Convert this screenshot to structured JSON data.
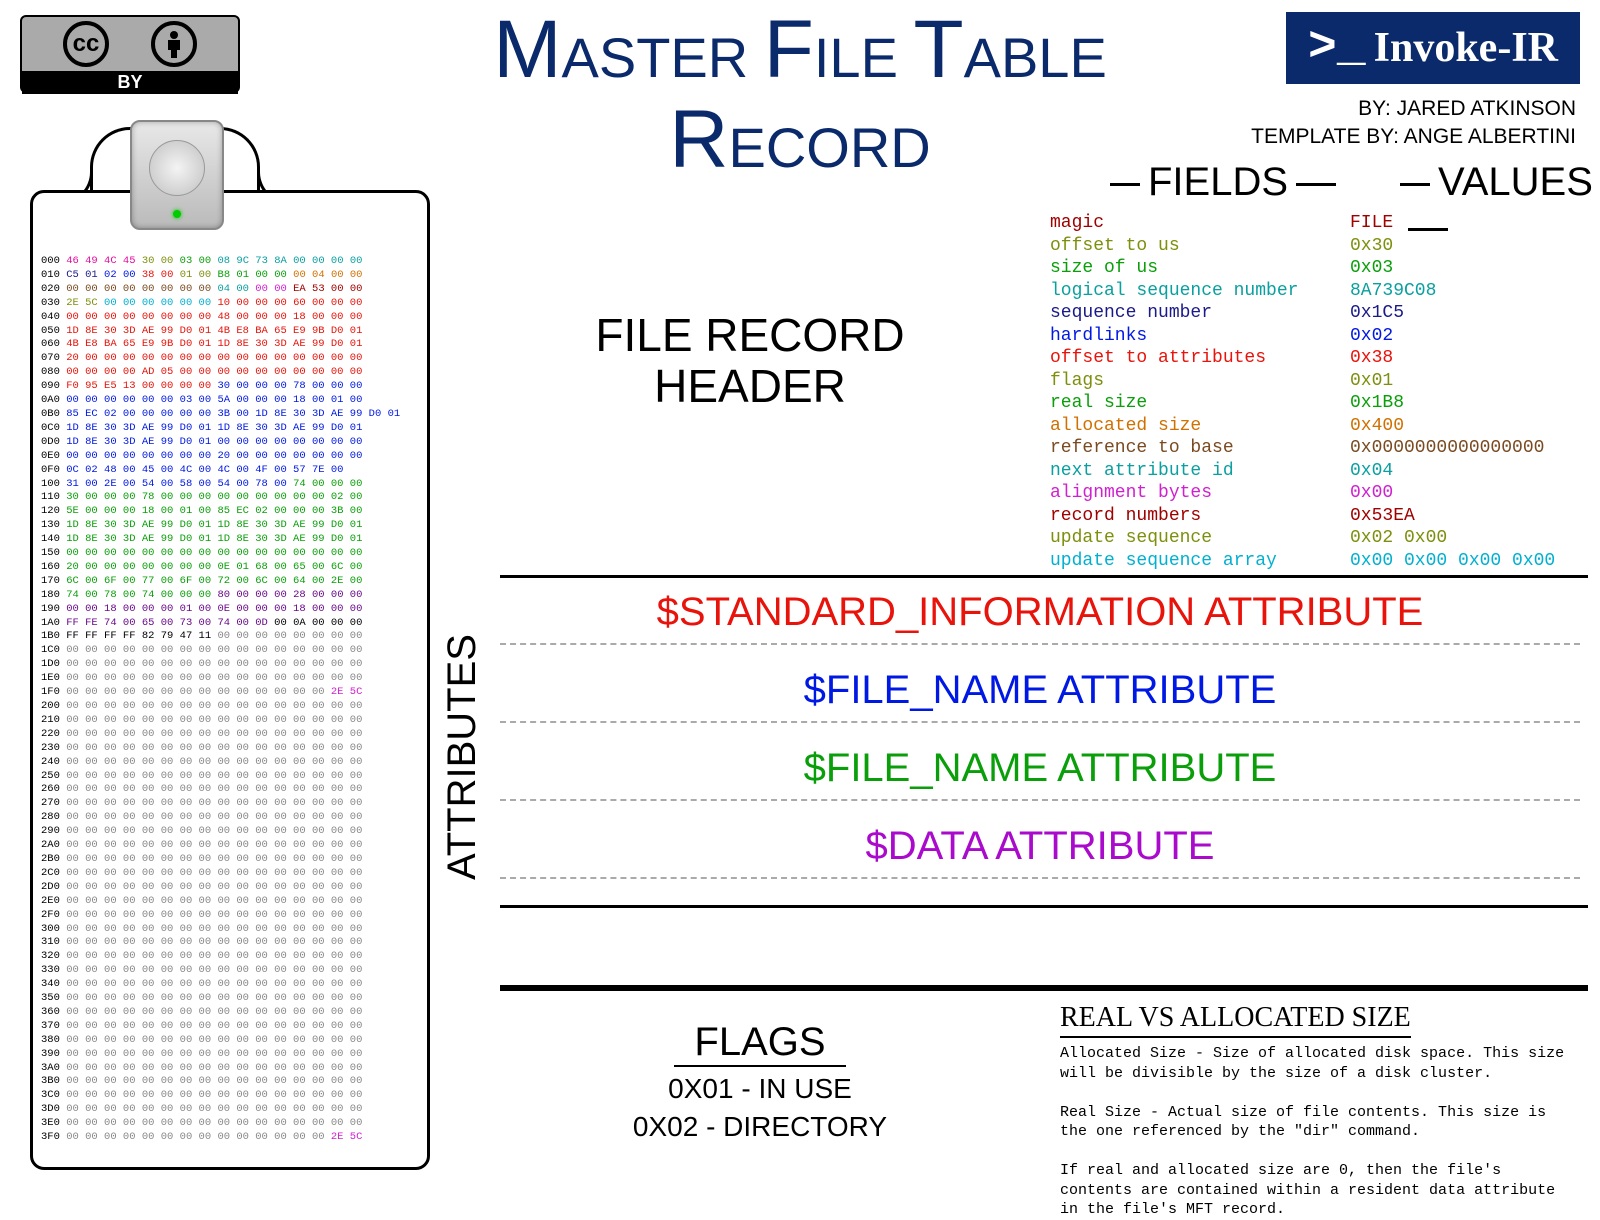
{
  "title_line1": "MASTER FILE TABLE",
  "title_line2": "RECORD",
  "cc": {
    "cc": "cc",
    "i": "i",
    "by": "BY"
  },
  "invoke": {
    "prompt": ">_",
    "name": "Invoke-IR"
  },
  "credits": {
    "by": "BY: JARED ATKINSON",
    "template": "TEMPLATE BY: ANGE ALBERTINI"
  },
  "headers": {
    "fields": "FIELDS",
    "values": "VALUES"
  },
  "sections": {
    "file_record_header": "FILE RECORD\nHEADER",
    "attributes": "ATTRIBUTES",
    "sia": "$STANDARD_INFORMATION ATTRIBUTE",
    "fn1": "$FILE_NAME ATTRIBUTE",
    "fn2": "$FILE_NAME ATTRIBUTE",
    "da": "$DATA ATTRIBUTE"
  },
  "fields": [
    {
      "name": "magic",
      "value": "FILE",
      "color": "c-dkred"
    },
    {
      "name": "offset to us",
      "value": "0x30",
      "color": "c-olive"
    },
    {
      "name": "size of us",
      "value": "0x03",
      "color": "c-green"
    },
    {
      "name": "logical sequence number",
      "value": "8A739C08",
      "color": "c-teal"
    },
    {
      "name": "sequence number",
      "value": "0x1C5",
      "color": "c-navy"
    },
    {
      "name": "hardlinks",
      "value": "0x02",
      "color": "c-blue"
    },
    {
      "name": "offset to attributes",
      "value": "0x38",
      "color": "c-red"
    },
    {
      "name": "flags",
      "value": "0x01",
      "color": "c-olive"
    },
    {
      "name": "real size",
      "value": "0x1B8",
      "color": "c-green"
    },
    {
      "name": "allocated size",
      "value": "0x400",
      "color": "c-orange"
    },
    {
      "name": "reference to base",
      "value": "0x0000000000000000",
      "color": "c-brown"
    },
    {
      "name": "next attribute id",
      "value": "0x04",
      "color": "c-teal"
    },
    {
      "name": "alignment bytes",
      "value": "0x00",
      "color": "c-magenta"
    },
    {
      "name": "record numbers",
      "value": "0x53EA",
      "color": "c-dkred"
    },
    {
      "name": "update sequence",
      "value": "0x02 0x00",
      "color": "c-olive"
    },
    {
      "name": "update sequence array",
      "value": "0x00 0x00 0x00 0x00",
      "color": "c-cyan"
    }
  ],
  "flags": {
    "header": "FLAGS",
    "l1": "0X01 - IN USE",
    "l2": "0X02 - DIRECTORY"
  },
  "rv": {
    "header": "REAL VS ALLOCATED SIZE",
    "p1": "Allocated Size - Size of allocated disk space. This size will be divisible by the size of a disk cluster.",
    "p2": "Real Size - Actual size of file contents. This size is the one referenced by the \"dir\" command.",
    "p3": "If real and allocated size are 0, then the file's contents are contained within a resident data attribute in the file's MFT record."
  },
  "hex_offsets": [
    "000",
    "010",
    "020",
    "030",
    "040",
    "050",
    "060",
    "070",
    "080",
    "090",
    "0A0",
    "0B0",
    "0C0",
    "0D0",
    "0E0",
    "0F0",
    "100",
    "110",
    "120",
    "130",
    "140",
    "150",
    "160",
    "170",
    "180",
    "190",
    "1A0",
    "1B0",
    "1C0",
    "1D0",
    "1E0",
    "1F0",
    "200",
    "210",
    "220",
    "230",
    "240",
    "250",
    "260",
    "270",
    "280",
    "290",
    "2A0",
    "2B0",
    "2C0",
    "2D0",
    "2E0",
    "2F0",
    "300",
    "310",
    "320",
    "330",
    "340",
    "350",
    "360",
    "370",
    "380",
    "390",
    "3A0",
    "3B0",
    "3C0",
    "3D0",
    "3E0",
    "3F0"
  ],
  "hex_rows": [
    [
      [
        "46 49 4C 45",
        "c-pink"
      ],
      [
        "30 00",
        "c-olive"
      ],
      [
        "03 00",
        "c-green"
      ],
      [
        "08 9C 73 8A",
        "c-teal"
      ],
      [
        "00 00 00 00",
        "c-teal"
      ]
    ],
    [
      [
        "C5 01",
        "c-navy"
      ],
      [
        "02 00",
        "c-blue"
      ],
      [
        "38 00",
        "c-red"
      ],
      [
        "01 00",
        "c-olive"
      ],
      [
        "B8 01 00 00",
        "c-green"
      ],
      [
        "00 04 00 00",
        "c-orange"
      ]
    ],
    [
      [
        "00 00 00 00 00 00 00 00",
        "c-brown"
      ],
      [
        "04 00",
        "c-teal"
      ],
      [
        "00 00",
        "c-magenta"
      ],
      [
        "EA 53 00 00",
        "c-dkred"
      ]
    ],
    [
      [
        "2E 5C",
        "c-olive"
      ],
      [
        "00 00 00 00 00 00",
        "c-cyan"
      ],
      [
        "10 00 00 00 60 00 00 00",
        "c-red"
      ]
    ],
    [
      [
        "00 00 00 00 00 00 00 00 48 00 00 00 18 00 00 00",
        "c-red"
      ]
    ],
    [
      [
        "1D 8E 30 3D AE 99 D0 01 4B E8 BA 65 E9 9B D0 01",
        "c-red"
      ]
    ],
    [
      [
        "4B E8 BA 65 E9 9B D0 01 1D 8E 30 3D AE 99 D0 01",
        "c-red"
      ]
    ],
    [
      [
        "20 00 00 00 00 00 00 00 00 00 00 00 00 00 00 00",
        "c-red"
      ]
    ],
    [
      [
        "00 00 00 00 AD 05 00 00 00 00 00 00 00 00 00 00",
        "c-red"
      ]
    ],
    [
      [
        "F0 95 E5 13 00 00 00 00",
        "c-red"
      ],
      [
        "30 00 00 00 78 00 00 00",
        "c-blue"
      ]
    ],
    [
      [
        "00 00 00 00 00 00 03 00 5A 00 00 00 18 00 01 00",
        "c-blue"
      ]
    ],
    [
      [
        "85 EC 02 00 00 00 00 00 3B 00 1D 8E 30 3D AE 99 D0 01",
        "c-blue"
      ]
    ],
    [
      [
        "1D 8E 30 3D AE 99 D0 01 1D 8E 30 3D AE 99 D0 01",
        "c-blue"
      ]
    ],
    [
      [
        "1D 8E 30 3D AE 99 D0 01 00 00 00 00 00 00 00 00",
        "c-blue"
      ]
    ],
    [
      [
        "00 00 00 00 00 00 00 00 20 00 00 00 00 00 00 00",
        "c-blue"
      ]
    ],
    [
      [
        "0C 02 48 00 45 00 4C 00 4C 00 4F 00 57 7E 00",
        "c-blue"
      ]
    ],
    [
      [
        "31 00 2E 00 54 00 58 00 54 00 78 00",
        "c-blue"
      ],
      [
        "74 00 00 00",
        "c-green"
      ]
    ],
    [
      [
        "30 00 00 00 78 00 00 00 00 00 00 00 00 00 02 00",
        "c-green"
      ]
    ],
    [
      [
        "5E 00 00 00 18 00 01 00 85 EC 02 00 00 00 3B 00",
        "c-green"
      ]
    ],
    [
      [
        "1D 8E 30 3D AE 99 D0 01 1D 8E 30 3D AE 99 D0 01",
        "c-green"
      ]
    ],
    [
      [
        "1D 8E 30 3D AE 99 D0 01 1D 8E 30 3D AE 99 D0 01",
        "c-green"
      ]
    ],
    [
      [
        "00 00 00 00 00 00 00 00 00 00 00 00 00 00 00 00",
        "c-green"
      ]
    ],
    [
      [
        "20 00 00 00 00 00 00 00 0E 01 68 00 65 00 6C 00",
        "c-green"
      ]
    ],
    [
      [
        "6C 00 6F 00 77 00 6F 00 72 00 6C 00 64 00 2E 00",
        "c-green"
      ]
    ],
    [
      [
        "74 00 78 00 74 00 00 00",
        "c-green"
      ],
      [
        "80 00 00 00 28 00 00 00",
        "c-purple"
      ]
    ],
    [
      [
        "00 00 18 00 00 00 01 00 0E 00 00 00 18 00 00 00",
        "c-purple"
      ]
    ],
    [
      [
        "FF FE 74 00 65 00 73 00 74 00 0D",
        "c-purple"
      ],
      [
        "00 0A 00 00 00",
        "c-black"
      ]
    ],
    [
      [
        "FF FF FF FF 82 79 47 11",
        "c-black"
      ],
      [
        "00 00 00 00 00 00 00 00",
        "c-gray"
      ]
    ],
    [
      [
        "00 00 00 00 00 00 00 00 00 00 00 00 00 00 00 00",
        "c-gray"
      ]
    ],
    [
      [
        "00 00 00 00 00 00 00 00 00 00 00 00 00 00 00 00",
        "c-gray"
      ]
    ],
    [
      [
        "00 00 00 00 00 00 00 00 00 00 00 00 00 00 00 00",
        "c-gray"
      ]
    ],
    [
      [
        "00 00 00 00 00 00 00 00 00 00 00 00 00 00",
        "c-gray"
      ],
      [
        "2E 5C",
        "c-magenta"
      ]
    ],
    [
      [
        "00 00 00 00 00 00 00 00 00 00 00 00 00 00 00 00",
        "c-gray"
      ]
    ],
    [
      [
        "00 00 00 00 00 00 00 00 00 00 00 00 00 00 00 00",
        "c-gray"
      ]
    ],
    [
      [
        "00 00 00 00 00 00 00 00 00 00 00 00 00 00 00 00",
        "c-gray"
      ]
    ],
    [
      [
        "00 00 00 00 00 00 00 00 00 00 00 00 00 00 00 00",
        "c-gray"
      ]
    ],
    [
      [
        "00 00 00 00 00 00 00 00 00 00 00 00 00 00 00 00",
        "c-gray"
      ]
    ],
    [
      [
        "00 00 00 00 00 00 00 00 00 00 00 00 00 00 00 00",
        "c-gray"
      ]
    ],
    [
      [
        "00 00 00 00 00 00 00 00 00 00 00 00 00 00 00 00",
        "c-gray"
      ]
    ],
    [
      [
        "00 00 00 00 00 00 00 00 00 00 00 00 00 00 00 00",
        "c-gray"
      ]
    ],
    [
      [
        "00 00 00 00 00 00 00 00 00 00 00 00 00 00 00 00",
        "c-gray"
      ]
    ],
    [
      [
        "00 00 00 00 00 00 00 00 00 00 00 00 00 00 00 00",
        "c-gray"
      ]
    ],
    [
      [
        "00 00 00 00 00 00 00 00 00 00 00 00 00 00 00 00",
        "c-gray"
      ]
    ],
    [
      [
        "00 00 00 00 00 00 00 00 00 00 00 00 00 00 00 00",
        "c-gray"
      ]
    ],
    [
      [
        "00 00 00 00 00 00 00 00 00 00 00 00 00 00 00 00",
        "c-gray"
      ]
    ],
    [
      [
        "00 00 00 00 00 00 00 00 00 00 00 00 00 00 00 00",
        "c-gray"
      ]
    ],
    [
      [
        "00 00 00 00 00 00 00 00 00 00 00 00 00 00 00 00",
        "c-gray"
      ]
    ],
    [
      [
        "00 00 00 00 00 00 00 00 00 00 00 00 00 00 00 00",
        "c-gray"
      ]
    ],
    [
      [
        "00 00 00 00 00 00 00 00 00 00 00 00 00 00 00 00",
        "c-gray"
      ]
    ],
    [
      [
        "00 00 00 00 00 00 00 00 00 00 00 00 00 00 00 00",
        "c-gray"
      ]
    ],
    [
      [
        "00 00 00 00 00 00 00 00 00 00 00 00 00 00 00 00",
        "c-gray"
      ]
    ],
    [
      [
        "00 00 00 00 00 00 00 00 00 00 00 00 00 00 00 00",
        "c-gray"
      ]
    ],
    [
      [
        "00 00 00 00 00 00 00 00 00 00 00 00 00 00 00 00",
        "c-gray"
      ]
    ],
    [
      [
        "00 00 00 00 00 00 00 00 00 00 00 00 00 00 00 00",
        "c-gray"
      ]
    ],
    [
      [
        "00 00 00 00 00 00 00 00 00 00 00 00 00 00 00 00",
        "c-gray"
      ]
    ],
    [
      [
        "00 00 00 00 00 00 00 00 00 00 00 00 00 00 00 00",
        "c-gray"
      ]
    ],
    [
      [
        "00 00 00 00 00 00 00 00 00 00 00 00 00 00 00 00",
        "c-gray"
      ]
    ],
    [
      [
        "00 00 00 00 00 00 00 00 00 00 00 00 00 00 00 00",
        "c-gray"
      ]
    ],
    [
      [
        "00 00 00 00 00 00 00 00 00 00 00 00 00 00 00 00",
        "c-gray"
      ]
    ],
    [
      [
        "00 00 00 00 00 00 00 00 00 00 00 00 00 00 00 00",
        "c-gray"
      ]
    ],
    [
      [
        "00 00 00 00 00 00 00 00 00 00 00 00 00 00 00 00",
        "c-gray"
      ]
    ],
    [
      [
        "00 00 00 00 00 00 00 00 00 00 00 00 00 00 00 00",
        "c-gray"
      ]
    ],
    [
      [
        "00 00 00 00 00 00 00 00 00 00 00 00 00 00 00 00",
        "c-gray"
      ]
    ],
    [
      [
        "00 00 00 00 00 00 00 00 00 00 00 00 00 00",
        "c-gray"
      ],
      [
        "2E 5C",
        "c-magenta"
      ]
    ]
  ]
}
